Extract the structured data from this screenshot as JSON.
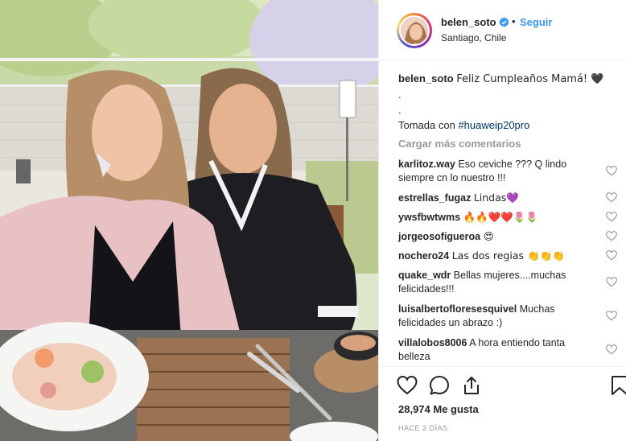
{
  "post": {
    "username": "belen_soto",
    "follow_label": "Seguir",
    "separator": "•",
    "location": "Santiago, Chile"
  },
  "caption": {
    "username": "belen_soto",
    "text": "Feliz Cumpleaños Mamá! 🖤",
    "line2": ".",
    "line3": ".",
    "line4_prefix": "Tomada con ",
    "hashtag": "#huaweip20pro"
  },
  "load_more": "Cargar más comentarios",
  "comments": [
    {
      "user": "karlitoz.way",
      "text": "Eso ceviche ??? Q lindo siempre cn lo nuestro !!!"
    },
    {
      "user": "estrellas_fugaz",
      "text": "Lindas💜"
    },
    {
      "user": "ywsfbwtwms",
      "text": "🔥🔥❤️❤️🌷🌷"
    },
    {
      "user": "jorgeosofigueroa",
      "text": "😍"
    },
    {
      "user": "nochero24",
      "text": "Las dos regias 👏👏👏"
    },
    {
      "user": "quake_wdr",
      "text": "Bellas mujeres....muchas felicidades!!!"
    },
    {
      "user": "luisalbertofloresesquivel",
      "text": "Muchas felicidades un abrazo :)"
    },
    {
      "user": "villalobos8006",
      "text": "A hora entiendo tanta belleza"
    }
  ],
  "likes": "28,974 Me gusta",
  "time_ago": "HACE 2 DÍAS",
  "icons": {
    "verified": "verified-badge-icon",
    "like": "heart-icon",
    "comment": "comment-bubble-icon",
    "share": "share-icon",
    "save": "bookmark-icon"
  },
  "colors": {
    "link": "#3897f0",
    "verified": "#3897f0",
    "muted": "#999999",
    "text": "#262626"
  }
}
